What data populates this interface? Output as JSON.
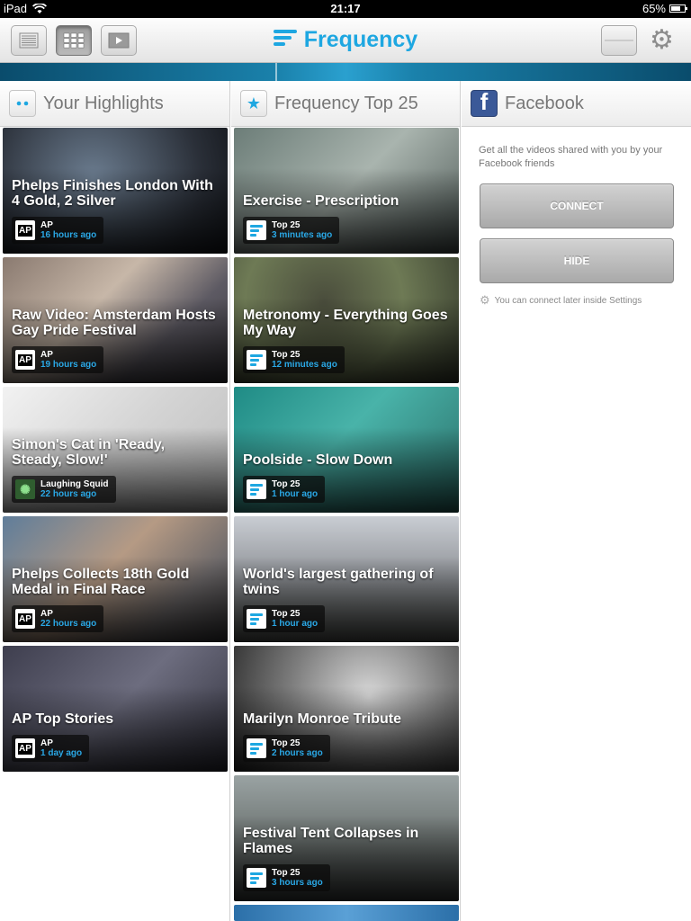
{
  "status": {
    "device": "iPad",
    "time": "21:17",
    "battery": "65%"
  },
  "app": {
    "title": "Frequency"
  },
  "columns": [
    {
      "title": "Your Highlights",
      "cards": [
        {
          "title": "Phelps Finishes London With 4 Gold, 2 Silver",
          "source": "AP",
          "time": "16 hours ago",
          "logo": "ap"
        },
        {
          "title": "Raw Video: Amsterdam Hosts Gay Pride Festival",
          "source": "AP",
          "time": "19 hours ago",
          "logo": "ap"
        },
        {
          "title": "Simon's Cat in 'Ready, Steady, Slow!'",
          "source": "Laughing Squid",
          "time": "22 hours ago",
          "logo": "squid"
        },
        {
          "title": "Phelps Collects 18th Gold Medal in Final Race",
          "source": "AP",
          "time": "22 hours ago",
          "logo": "ap"
        },
        {
          "title": "AP Top Stories",
          "source": "AP",
          "time": "1 day ago",
          "logo": "ap"
        }
      ]
    },
    {
      "title": "Frequency Top 25",
      "cards": [
        {
          "title": "Exercise - Prescription",
          "source": "Top 25",
          "time": "3 minutes ago",
          "logo": "top"
        },
        {
          "title": "Metronomy - Everything Goes My Way",
          "source": "Top 25",
          "time": "12 minutes ago",
          "logo": "top"
        },
        {
          "title": "Poolside - Slow Down",
          "source": "Top 25",
          "time": "1 hour ago",
          "logo": "top"
        },
        {
          "title": "World's largest gathering of twins",
          "source": "Top 25",
          "time": "1 hour ago",
          "logo": "top"
        },
        {
          "title": "Marilyn Monroe Tribute",
          "source": "Top 25",
          "time": "2 hours ago",
          "logo": "top"
        },
        {
          "title": "Festival Tent Collapses in Flames",
          "source": "Top 25",
          "time": "3 hours ago",
          "logo": "top"
        }
      ]
    },
    {
      "title": "Facebook",
      "description": "Get all the videos shared with you by your Facebook friends",
      "connect_label": "CONNECT",
      "hide_label": "HIDE",
      "note": "You can connect later inside Settings"
    }
  ],
  "colors": {
    "accent": "#1ea7e1",
    "facebook": "#3b5998"
  }
}
